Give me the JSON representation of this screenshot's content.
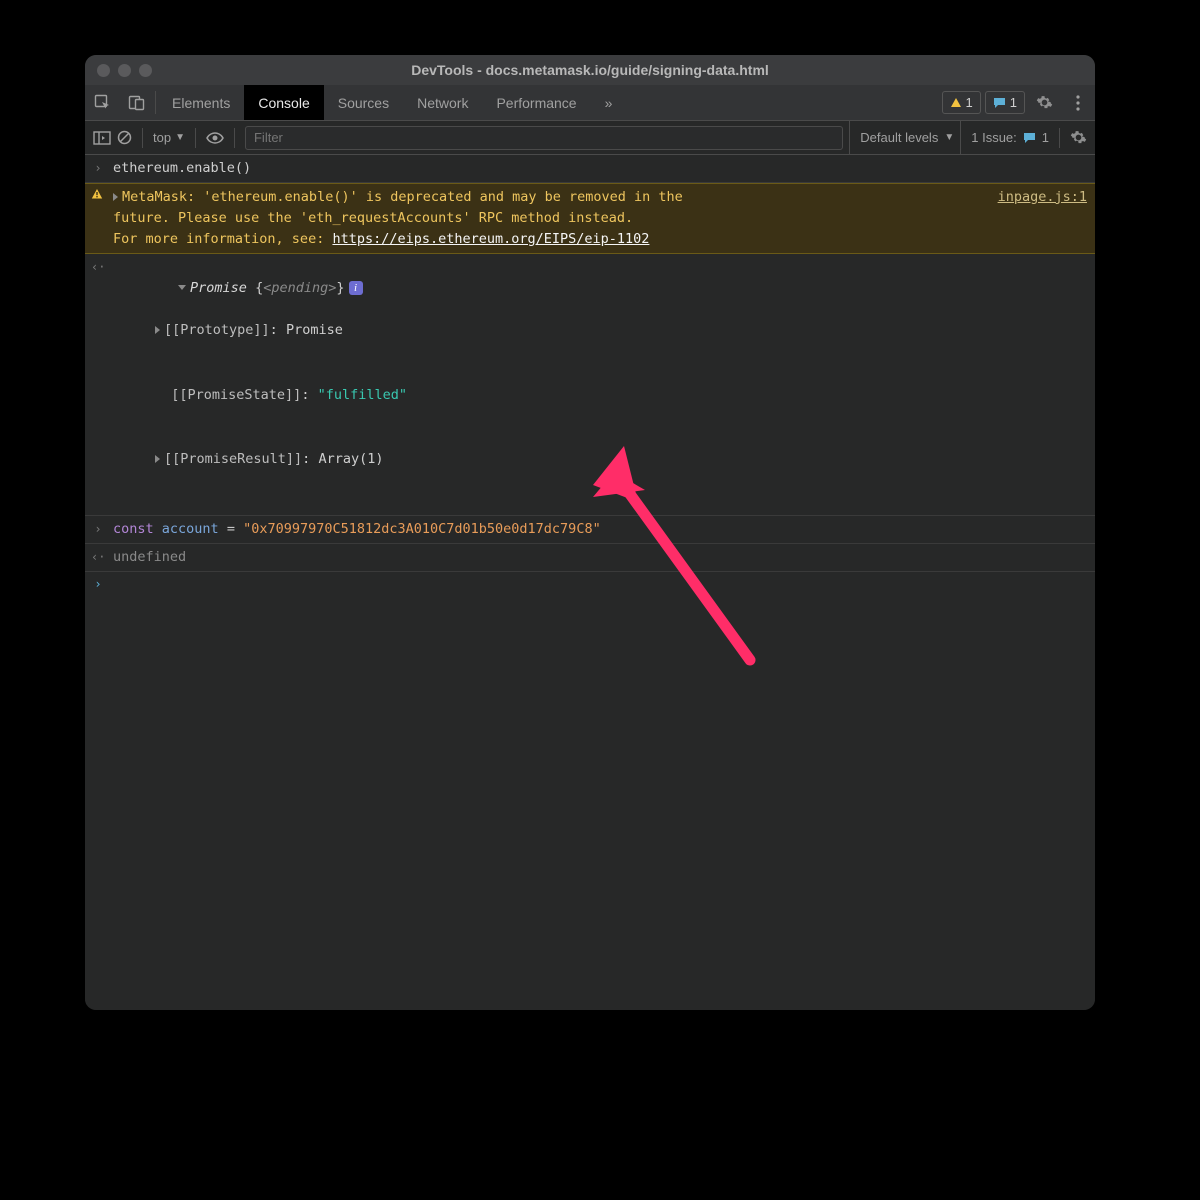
{
  "title": "DevTools - docs.metamask.io/guide/signing-data.html",
  "tabs": {
    "elements": "Elements",
    "console": "Console",
    "sources": "Sources",
    "network": "Network",
    "performance": "Performance",
    "more": "»"
  },
  "badges": {
    "warn_count": "1",
    "err_count": "1"
  },
  "toolbar": {
    "context": "top",
    "filter_placeholder": "Filter",
    "levels": "Default levels",
    "issues_label": "1 Issue:",
    "issues_count": "1"
  },
  "log": {
    "cmd1": "ethereum.enable()",
    "warn_l1": "MetaMask: 'ethereum.enable()' is deprecated and may be removed in the",
    "warn_l2": "future. Please use the 'eth_requestAccounts' RPC method instead.",
    "warn_l3_pre": "For more information, see: ",
    "warn_link": "https://eips.ethereum.org/EIPS/eip-1102",
    "warn_src": "inpage.js:1",
    "promise_label": "Promise",
    "promise_state_tag": "<pending>",
    "proto_key": "[[Prototype]]",
    "proto_val": "Promise",
    "state_key": "[[PromiseState]]",
    "state_val": "\"fulfilled\"",
    "result_key": "[[PromiseResult]]",
    "result_val": "Array(1)",
    "cmd2_kw": "const",
    "cmd2_var": "account",
    "cmd2_eq": " = ",
    "cmd2_str": "\"0x70997970C51812dc3A010C7d01b50e0d17dc79C8\"",
    "undef": "undefined"
  }
}
